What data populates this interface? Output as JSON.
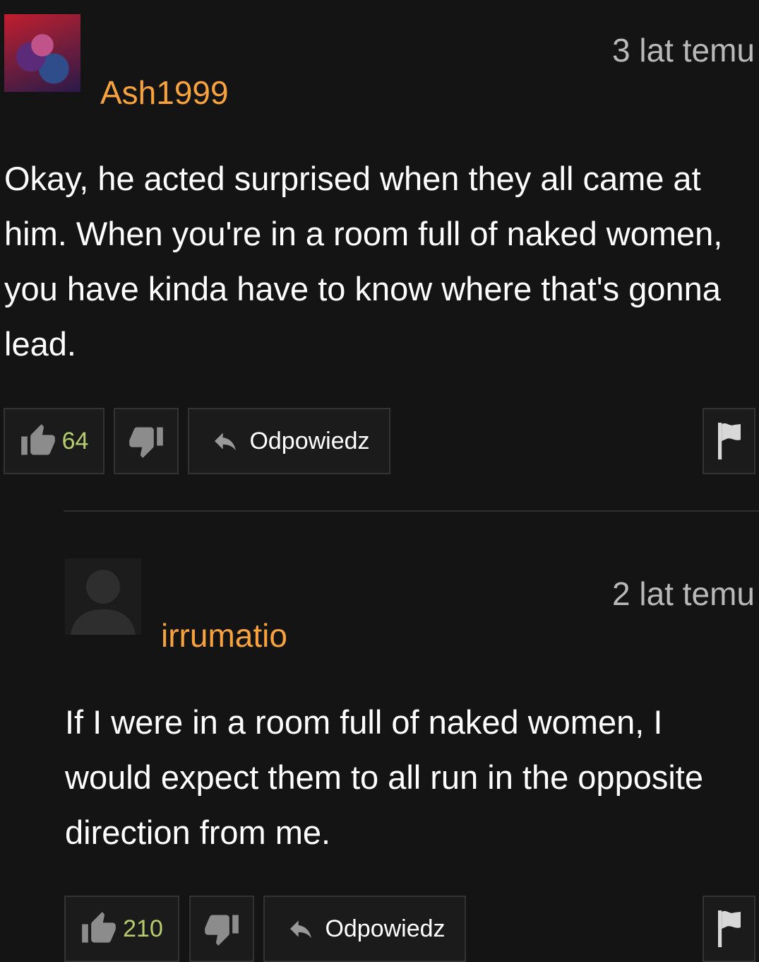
{
  "comments": [
    {
      "username": "Ash1999",
      "timestamp": "3 lat temu",
      "text": "Okay, he acted surprised when they all came at him. When you're in a room full of naked women, you have kinda have to know where that's gonna lead.",
      "likes": "64",
      "reply_label": "Odpowiedz"
    },
    {
      "username": "irrumatio",
      "timestamp": "2 lat temu",
      "text": "If I were in a room full of naked women, I would expect them to all run in the opposite direction from me.",
      "likes": "210",
      "reply_label": "Odpowiedz"
    }
  ],
  "colors": {
    "background": "#141414",
    "username": "#f7a23a",
    "timestamp": "#b9b9b9",
    "like_count": "#b7cc6c",
    "button_bg": "#1b1b1b",
    "button_border": "#333333"
  },
  "icons": {
    "like": "thumbs-up-icon",
    "dislike": "thumbs-down-icon",
    "reply": "reply-arrow-icon",
    "flag": "flag-icon",
    "default_avatar": "user-silhouette-icon"
  }
}
